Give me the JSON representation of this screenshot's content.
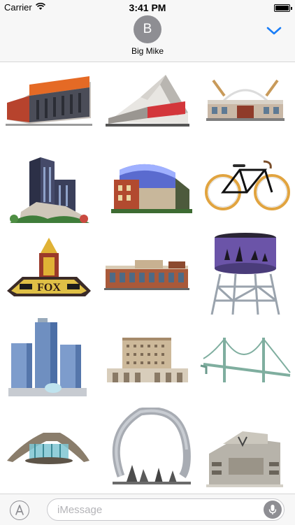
{
  "status_bar": {
    "carrier": "Carrier",
    "time": "3:41 PM"
  },
  "header": {
    "avatar_initial": "B",
    "contact_name": "Big Mike"
  },
  "stickers": [
    {
      "name": "arena"
    },
    {
      "name": "pyramid-building"
    },
    {
      "name": "ballpark"
    },
    {
      "name": "art-deco-tower"
    },
    {
      "name": "glass-arena"
    },
    {
      "name": "bicycle"
    },
    {
      "name": "theatre-marquee",
      "text": "FOX"
    },
    {
      "name": "low-market-building"
    },
    {
      "name": "water-tower"
    },
    {
      "name": "glass-towers"
    },
    {
      "name": "train-station"
    },
    {
      "name": "suspension-bridge"
    },
    {
      "name": "fountain"
    },
    {
      "name": "ring-sculpture"
    },
    {
      "name": "stadium-entrance"
    }
  ],
  "compose": {
    "placeholder": "iMessage"
  }
}
